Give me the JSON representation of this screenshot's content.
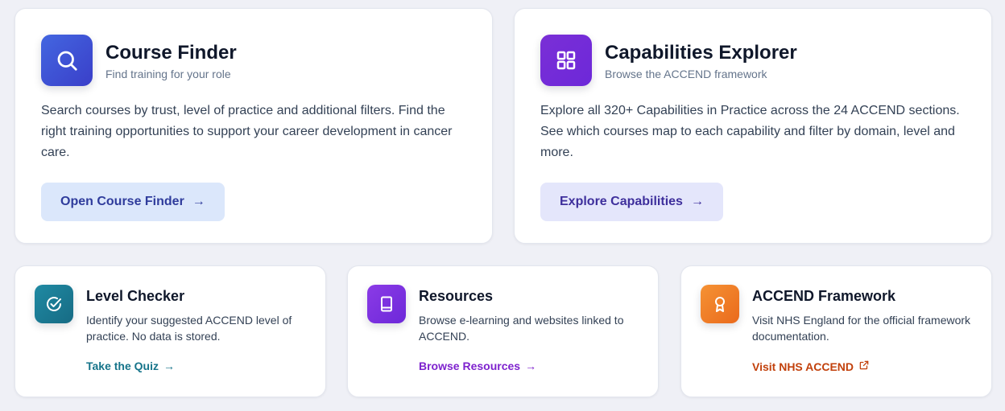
{
  "course_finder": {
    "title": "Course Finder",
    "subtitle": "Find training for your role",
    "description": "Search courses by trust, level of practice and additional filters. Find the right training opportunities to support your career development in cancer care.",
    "button_label": "Open Course Finder",
    "icon": "search-icon",
    "color": "#3b5bdb"
  },
  "capabilities_explorer": {
    "title": "Capabilities Explorer",
    "subtitle": "Browse the ACCEND framework",
    "description": "Explore all 320+ Capabilities in Practice across the 24 ACCEND sections. See which courses map to each capability and filter by domain, level and more.",
    "button_label": "Explore Capabilities",
    "icon": "grid-icon",
    "color": "#7e22ce"
  },
  "level_checker": {
    "title": "Level Checker",
    "description": "Identify your suggested ACCEND level of practice. No data is stored.",
    "link_label": "Take the Quiz",
    "icon": "check-circle-icon",
    "color": "#1b7b94"
  },
  "resources": {
    "title": "Resources",
    "description": "Browse e-learning and websites linked to ACCEND.",
    "link_label": "Browse Resources",
    "icon": "book-icon",
    "color": "#7c2fd9"
  },
  "accend_framework": {
    "title": "ACCEND Framework",
    "description": "Visit NHS England for the official framework documentation.",
    "link_label": "Visit NHS ACCEND",
    "icon": "award-icon",
    "color": "#f07a24"
  }
}
